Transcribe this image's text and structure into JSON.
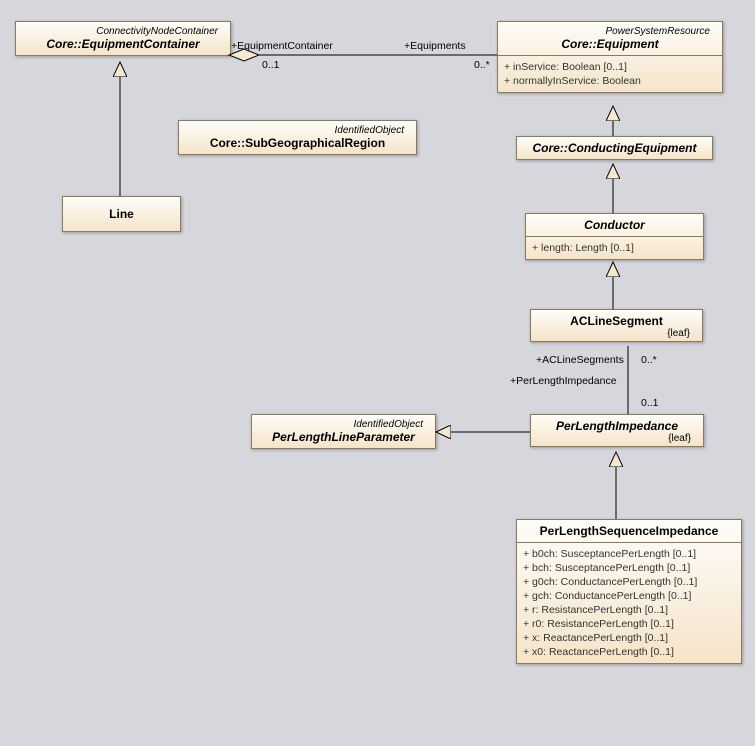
{
  "classes": {
    "equipmentContainer": {
      "stereotype": "ConnectivityNodeContainer",
      "name": "Core::EquipmentContainer"
    },
    "equipment": {
      "stereotype": "PowerSystemResource",
      "name": "Core::Equipment",
      "attrs": [
        "+   inService: Boolean [0..1]",
        "+   normallyInService: Boolean"
      ]
    },
    "subGeo": {
      "stereotype": "IdentifiedObject",
      "name": "Core::SubGeographicalRegion"
    },
    "conductingEquipment": {
      "name": "Core::ConductingEquipment"
    },
    "line": {
      "name": "Line"
    },
    "conductor": {
      "name": "Conductor",
      "attrs": [
        "+   length: Length [0..1]"
      ]
    },
    "acLineSegment": {
      "name": "ACLineSegment",
      "constraint": "{leaf}"
    },
    "perLengthLineParameter": {
      "stereotype": "IdentifiedObject",
      "name": "PerLengthLineParameter"
    },
    "perLengthImpedance": {
      "name": "PerLengthImpedance",
      "constraint": "{leaf}"
    },
    "perLengthSequenceImpedance": {
      "name": "PerLengthSequenceImpedance",
      "attrs": [
        "+   b0ch: SusceptancePerLength [0..1]",
        "+   bch: SusceptancePerLength [0..1]",
        "+   g0ch: ConductancePerLength [0..1]",
        "+   gch: ConductancePerLength [0..1]",
        "+   r: ResistancePerLength [0..1]",
        "+   r0: ResistancePerLength [0..1]",
        "+   x: ReactancePerLength [0..1]",
        "+   x0: ReactancePerLength [0..1]"
      ]
    }
  },
  "labels": {
    "equipmentContainerRole": "+EquipmentContainer",
    "equipmentContainerMult": "0..1",
    "equipmentsRole": "+Equipments",
    "equipmentsMult": "0..*",
    "acLineSegmentsRole": "+ACLineSegments",
    "acLineSegmentsMult": "0..*",
    "perLengthImpedanceRole": "+PerLengthImpedance",
    "perLengthImpedanceMult": "0..1"
  }
}
